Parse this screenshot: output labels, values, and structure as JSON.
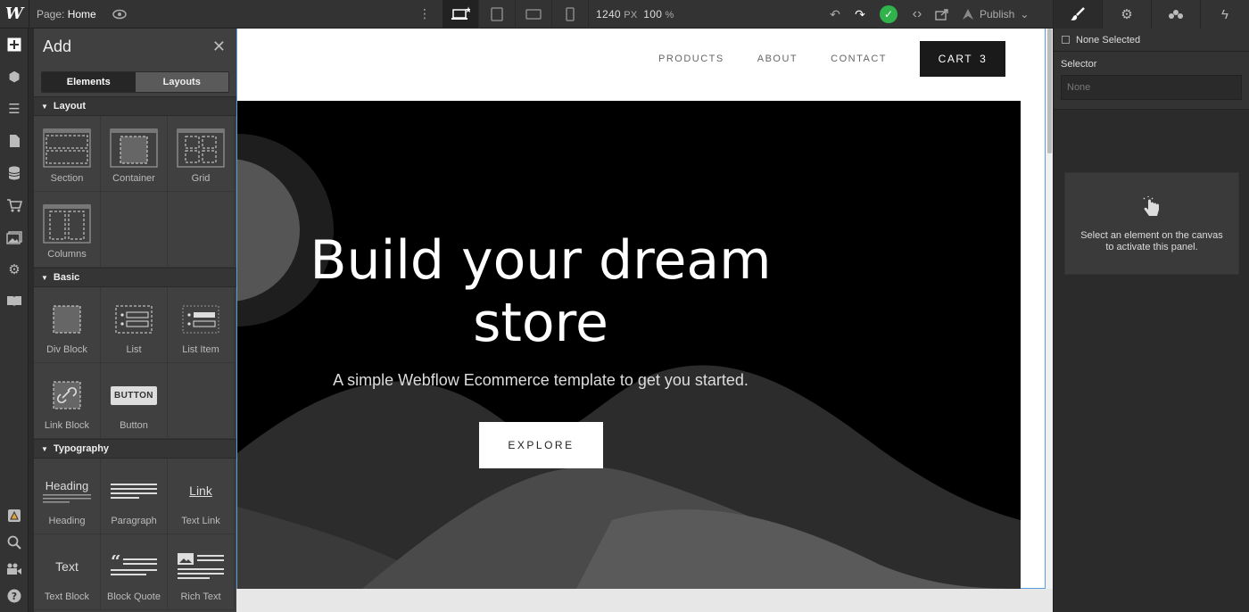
{
  "topbar": {
    "logo": "W",
    "page_prefix": "Page:",
    "page_name": "Home",
    "width_value": "1240",
    "width_unit": "PX",
    "zoom_value": "100",
    "zoom_unit": "%",
    "publish_label": "Publish"
  },
  "addpanel": {
    "title": "Add",
    "tabs": [
      "Elements",
      "Layouts"
    ],
    "categories": {
      "layout": "Layout",
      "basic": "Basic",
      "typography": "Typography"
    },
    "layout_items": [
      "Section",
      "Container",
      "Grid",
      "Columns"
    ],
    "basic_items": [
      "Div Block",
      "List",
      "List Item",
      "Link Block",
      "Button"
    ],
    "button_thumb": "BUTTON",
    "typography_items": [
      "Heading",
      "Paragraph",
      "Text Link",
      "Text Block",
      "Block Quote",
      "Rich Text"
    ],
    "heading_thumb": "Heading",
    "link_thumb": "Link",
    "text_thumb": "Text"
  },
  "site": {
    "nav": [
      "PRODUCTS",
      "ABOUT",
      "CONTACT"
    ],
    "cart_label": "CART",
    "cart_count": "3",
    "hero_title": "Build your dream store",
    "hero_subtitle": "A simple Webflow Ecommerce template to get you started.",
    "cta": "EXPLORE"
  },
  "rightpanel": {
    "none_selected": "None Selected",
    "selector_label": "Selector",
    "selector_placeholder": "None",
    "empty_message": "Select an element on the canvas to activate this panel."
  },
  "colors": {
    "publish_status": "#2fb34a",
    "hero_bg": "#000000",
    "canvas_outline": "#5aa0e0"
  }
}
